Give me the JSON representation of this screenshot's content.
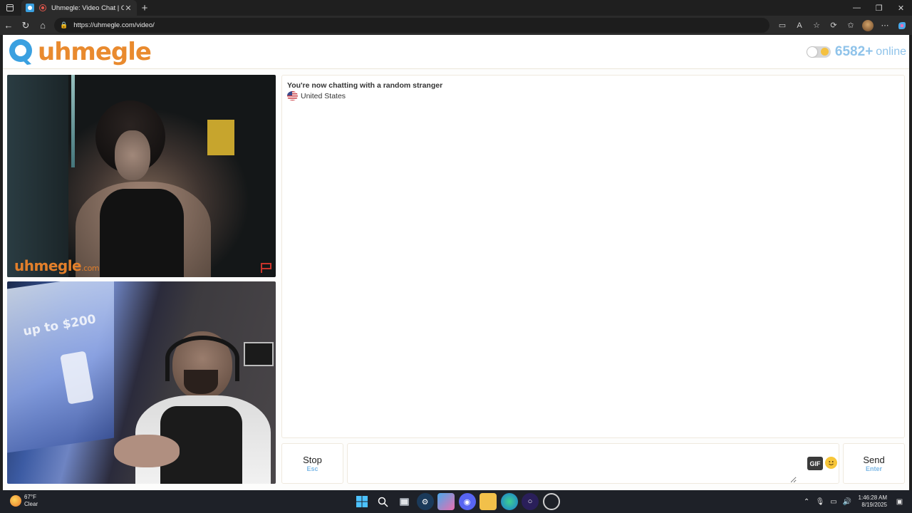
{
  "browser": {
    "tab_title": "Uhmegle: Video Chat | Omegle",
    "url": "https://uhmegle.com/video/"
  },
  "site": {
    "logo_text": "uhmegle",
    "online_count": "6582+",
    "online_label": "online",
    "theme_toggle_state": "light"
  },
  "video": {
    "watermark": "uhmegle",
    "watermark_suffix": ".com",
    "self_screen_text": "up to $200"
  },
  "chat": {
    "status": "You're now chatting with a random stranger",
    "country": "United States"
  },
  "controls": {
    "stop_label": "Stop",
    "stop_key": "Esc",
    "send_label": "Send",
    "send_key": "Enter",
    "message_value": "",
    "gif_label": "GIF"
  },
  "taskbar": {
    "temperature": "67°F",
    "condition": "Clear",
    "time": "1:46:28 AM",
    "date": "8/19/2025"
  },
  "colors": {
    "brand_orange": "#e98a2e",
    "brand_blue": "#3aa0e0",
    "accent_light_blue": "#8fc3ea"
  }
}
